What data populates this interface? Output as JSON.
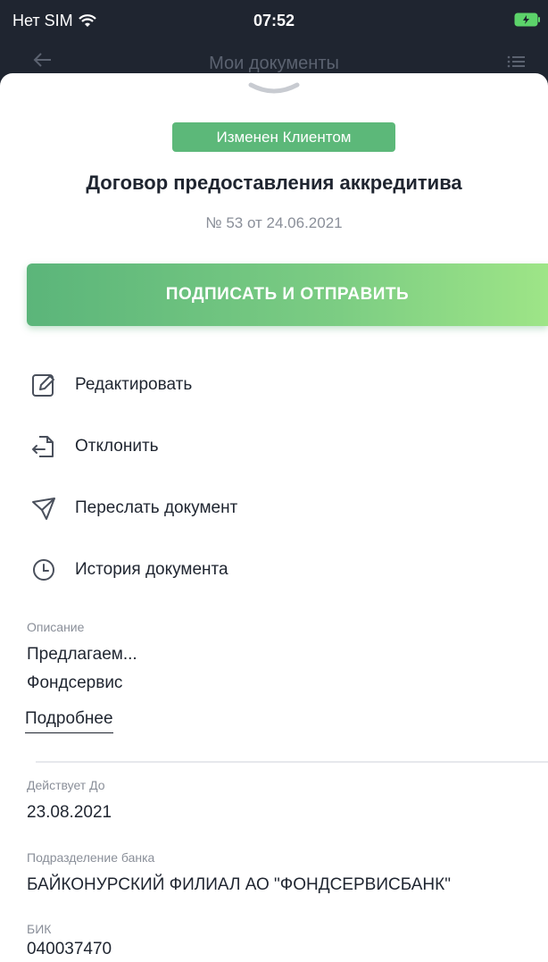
{
  "status_bar": {
    "carrier": "Нет SIM",
    "time": "07:52"
  },
  "nav": {
    "title": "Мои документы"
  },
  "document": {
    "status_badge": "Изменен Клиентом",
    "title": "Договор предоставления аккредитива",
    "number": "№ 53 от 24.06.2021"
  },
  "primary_action": {
    "label": "ПОДПИСАТЬ И ОТПРАВИТЬ"
  },
  "actions": [
    {
      "label": "Редактировать",
      "icon": "edit-icon"
    },
    {
      "label": "Отклонить",
      "icon": "reject-icon"
    },
    {
      "label": "Переслать документ",
      "icon": "send-icon"
    },
    {
      "label": "История документа",
      "icon": "history-icon"
    }
  ],
  "description": {
    "label": "Описание",
    "line1": "Предлагаем...",
    "line2": "Фондсервис",
    "more_link": "Подробнее"
  },
  "fields": [
    {
      "label": "Действует До",
      "value": "23.08.2021"
    },
    {
      "label": "Подразделение банка",
      "value": "БАЙКОНУРСКИЙ ФИЛИАЛ АО \"ФОНДСЕРВИСБАНК\""
    },
    {
      "label": "БИК",
      "value": "040037470"
    }
  ],
  "colors": {
    "accent_green": "#5cb879",
    "header_bg": "#1f2530",
    "icon_gray": "#4a505c"
  }
}
